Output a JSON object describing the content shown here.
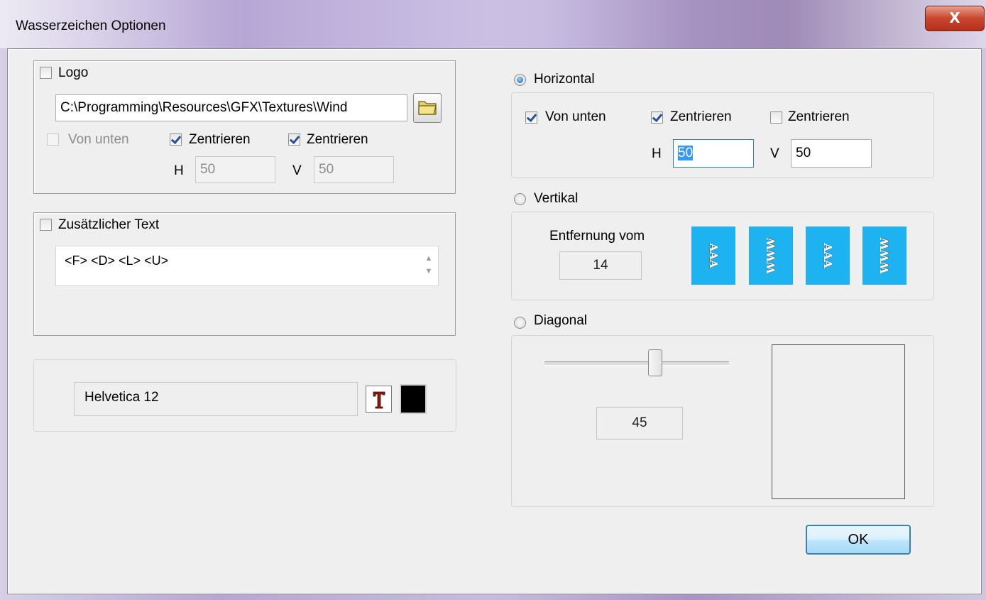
{
  "window": {
    "title": "Wasserzeichen Optionen",
    "close_label": "X"
  },
  "logo": {
    "label": "Logo",
    "checked": false,
    "path": "C:\\Programming\\Resources\\GFX\\Textures\\Wind",
    "von_unten": "Von unten",
    "zentrieren_h": "Zentrieren",
    "zentrieren_v": "Zentrieren",
    "h_label": "H",
    "h_value": "50",
    "v_label": "V",
    "v_value": "50"
  },
  "text": {
    "label": "Zusätzlicher Text",
    "checked": false,
    "value": "<F>  <D>  <L>  <U>"
  },
  "font": {
    "value": "Helvetica 12",
    "font_icon": "font-picker-icon",
    "color_swatch": "#000000"
  },
  "horizontal": {
    "label": "Horizontal",
    "selected": true,
    "von_unten": "Von unten",
    "zentrieren_h": "Zentrieren",
    "zentrieren_v": "Zentrieren",
    "h_label": "H",
    "h_value": "50",
    "v_label": "V",
    "v_value": "50"
  },
  "vertikal": {
    "label": "Vertikal",
    "selected": false,
    "distance_label": "Entfernung vom",
    "distance_value": "14",
    "tiles": [
      "AAA",
      "WWW",
      "AAA",
      "WWW"
    ],
    "tile_color": "#1db3f0"
  },
  "diagonal": {
    "label": "Diagonal",
    "selected": false,
    "angle_value": "45",
    "slider_fraction": 0.6
  },
  "buttons": {
    "ok": "OK"
  }
}
